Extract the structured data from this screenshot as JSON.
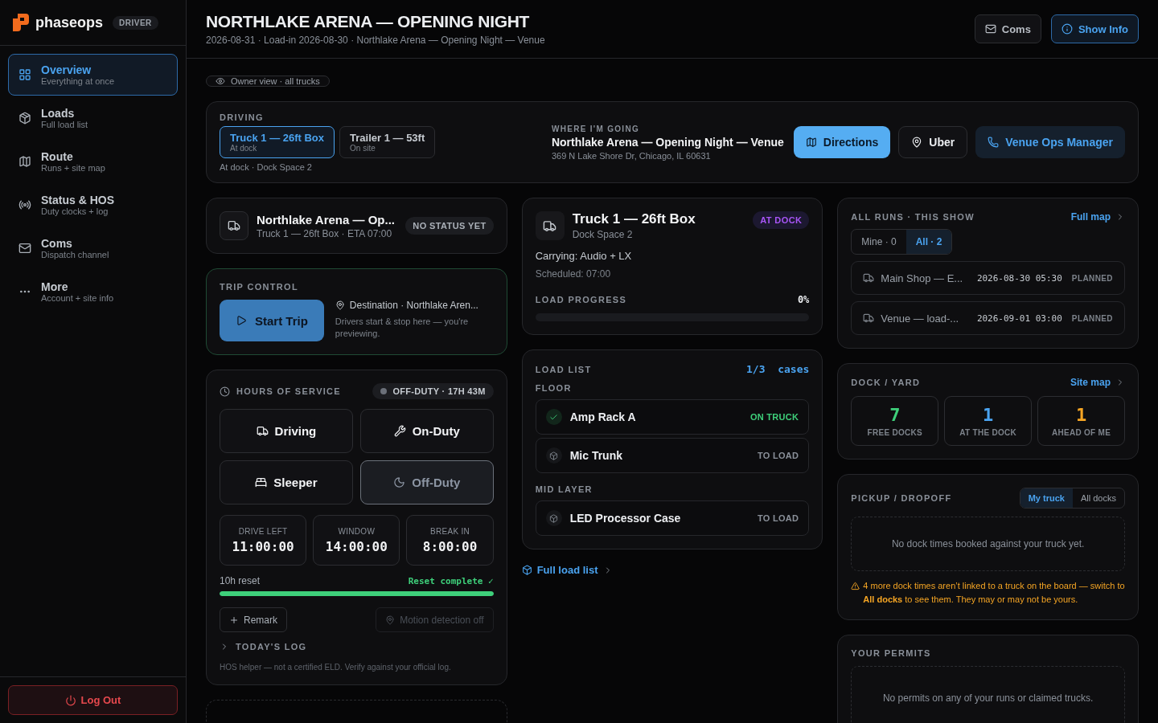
{
  "brand": {
    "name": "phaseops",
    "badge": "DRIVER"
  },
  "nav": [
    {
      "label": "Overview",
      "sub": "Everything at once",
      "selected": true
    },
    {
      "label": "Loads",
      "sub": "Full load list",
      "selected": false
    },
    {
      "label": "Route",
      "sub": "Runs + site map",
      "selected": false
    },
    {
      "label": "Status & HOS",
      "sub": "Duty clocks + log",
      "selected": false
    },
    {
      "label": "Coms",
      "sub": "Dispatch channel",
      "selected": false
    },
    {
      "label": "More",
      "sub": "Account + site info",
      "selected": false
    }
  ],
  "logout": "Log Out",
  "header": {
    "title": "NORTHLAKE ARENA — OPENING NIGHT",
    "subtitle": "2026-08-31 · Load-in 2026-08-30 · Northlake Arena — Opening Night — Venue",
    "buttons": [
      {
        "label": "Coms",
        "kind": "plain"
      },
      {
        "label": "Show Info",
        "kind": "primary"
      }
    ]
  },
  "view_chip": "Owner view · all trucks",
  "driving": {
    "label": "DRIVING",
    "vehicles": [
      {
        "name": "Truck 1 — 26ft Box",
        "status": "At dock",
        "selected": true
      },
      {
        "name": "Trailer 1 — 53ft",
        "status": "On site",
        "selected": false
      }
    ],
    "location": "At dock · Dock Space 2",
    "destination": {
      "label": "WHERE I'M GOING",
      "name": "Northlake Arena — Opening Night — Venue",
      "address": "369 N Lake Shore Dr, Chicago, IL 60631"
    },
    "actions": [
      {
        "label": "Directions",
        "kind": "primary"
      },
      {
        "label": "Uber",
        "kind": "plain"
      },
      {
        "label": "Venue Ops Manager",
        "kind": "contact"
      }
    ]
  },
  "run_card": {
    "title": "Northlake Arena — Op...",
    "subtitle": "Truck 1 — 26ft Box · ETA 07:00",
    "status": "NO STATUS YET"
  },
  "trip_control": {
    "label": "TRIP CONTROL",
    "button": "Start Trip",
    "destination": "Destination · Northlake Aren...",
    "note": "Drivers start & stop here — you're previewing."
  },
  "hos": {
    "label": "HOURS OF SERVICE",
    "status": "OFF-DUTY · 17H 43M",
    "duties": [
      {
        "label": "Driving",
        "selected": false
      },
      {
        "label": "On-Duty",
        "selected": false
      },
      {
        "label": "Sleeper",
        "selected": false
      },
      {
        "label": "Off-Duty",
        "selected": true
      }
    ],
    "clocks": [
      {
        "label": "DRIVE LEFT",
        "value": "11:00:00"
      },
      {
        "label": "WINDOW",
        "value": "14:00:00"
      },
      {
        "label": "BREAK IN",
        "value": "8:00:00"
      }
    ],
    "reset": {
      "label": "10h reset",
      "status": "Reset complete ✓",
      "level": 1
    },
    "remark": "Remark",
    "motion": {
      "label": "Motion detection off",
      "disabled": true
    },
    "log": {
      "label": "TODAY'S LOG",
      "expanded": false
    },
    "footnote": "HOS helper — not a certified ELD. Verify against your official log."
  },
  "truck": {
    "title": "Truck 1 — 26ft Box",
    "subtitle": "Dock Space 2",
    "status": "AT DOCK",
    "carrying": "Carrying: Audio + LX",
    "scheduled": "Scheduled: 07:00",
    "progress": {
      "label": "LOAD PROGRESS",
      "reading": "0%",
      "level": 0
    }
  },
  "load_list": {
    "label": "LOAD LIST",
    "count": "1/3  cases",
    "groups": [
      {
        "name": "FLOOR",
        "items": [
          {
            "name": "Amp Rack A",
            "status": "ON TRUCK",
            "loaded": true
          },
          {
            "name": "Mic Trunk",
            "status": "TO LOAD",
            "loaded": false
          }
        ]
      },
      {
        "name": "MID LAYER",
        "items": [
          {
            "name": "LED Processor Case",
            "status": "TO LOAD",
            "loaded": false
          }
        ]
      }
    ]
  },
  "full_load_link": "Full load list",
  "runs": {
    "label": "ALL RUNS · THIS SHOW",
    "link": "Full map",
    "filters": [
      {
        "label": "Mine · 0",
        "selected": false
      },
      {
        "label": "All · 2",
        "selected": true
      }
    ],
    "items": [
      {
        "name": "Main Shop — E...",
        "time": "2026-08-30 05:30",
        "status": "PLANNED"
      },
      {
        "name": "Venue — load-...",
        "time": "2026-09-01 03:00",
        "status": "PLANNED"
      }
    ]
  },
  "dock": {
    "label": "DOCK / YARD",
    "link": "Site map",
    "stats": [
      {
        "value": "7",
        "label": "FREE DOCKS",
        "color": "#3ecf7a"
      },
      {
        "value": "1",
        "label": "AT THE DOCK",
        "color": "#4aa3f0"
      },
      {
        "value": "1",
        "label": "AHEAD OF ME",
        "color": "#f5a524"
      }
    ]
  },
  "pickup": {
    "label": "PICKUP / DROPOFF",
    "filters": [
      {
        "label": "My truck",
        "selected": true
      },
      {
        "label": "All docks",
        "selected": false
      }
    ],
    "empty": "No dock times booked against your truck yet.",
    "warning": "4 more dock times aren’t linked to a truck on the board — switch to **All docks** to see them. They may or may not be yours."
  },
  "permits": {
    "label": "YOUR PERMITS",
    "empty": "No permits on any of your runs or claimed trucks."
  }
}
